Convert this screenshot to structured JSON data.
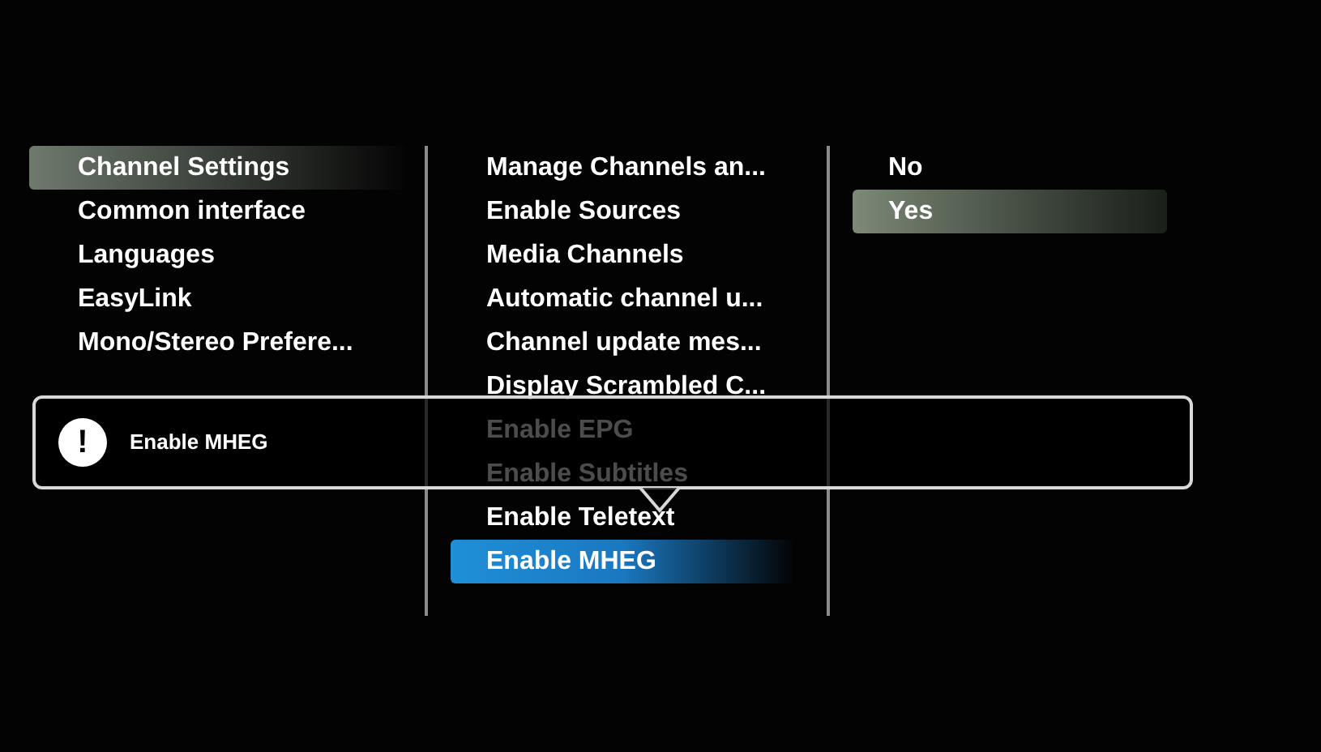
{
  "columns": [
    {
      "active": false,
      "items": [
        {
          "label": "Channel Settings",
          "selected": true
        },
        {
          "label": "Common interface",
          "selected": false
        },
        {
          "label": "Languages",
          "selected": false
        },
        {
          "label": "EasyLink",
          "selected": false
        },
        {
          "label": "Mono/Stereo Prefere...",
          "selected": false
        }
      ]
    },
    {
      "active": true,
      "items": [
        {
          "label": "Manage Channels an...",
          "selected": false
        },
        {
          "label": "Enable Sources",
          "selected": false
        },
        {
          "label": "Media Channels",
          "selected": false
        },
        {
          "label": "Automatic channel u...",
          "selected": false
        },
        {
          "label": "Channel update mes...",
          "selected": false
        },
        {
          "label": "Display Scrambled C...",
          "selected": false
        },
        {
          "label": "Enable EPG",
          "selected": false
        },
        {
          "label": "Enable Subtitles",
          "selected": false
        },
        {
          "label": "Enable Teletext",
          "selected": false
        },
        {
          "label": "Enable MHEG",
          "selected": true
        }
      ]
    },
    {
      "active": false,
      "items": [
        {
          "label": "No",
          "selected": false
        },
        {
          "label": "Yes",
          "selected": true
        }
      ]
    }
  ],
  "tooltip": {
    "icon": "!",
    "text": "Enable MHEG"
  }
}
